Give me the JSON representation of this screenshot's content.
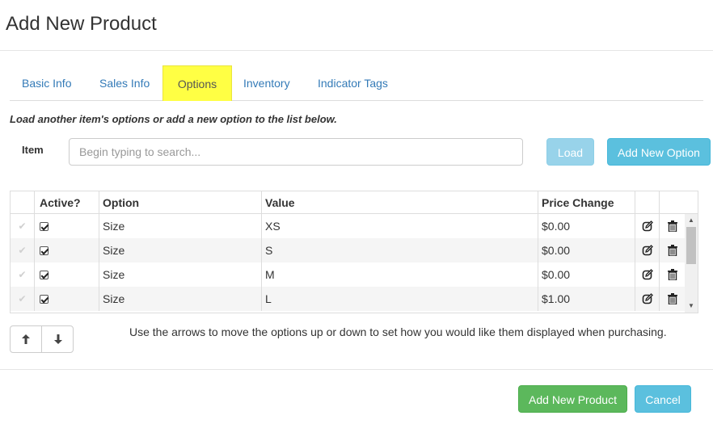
{
  "modal": {
    "title": "Add New Product"
  },
  "tabs": [
    {
      "label": "Basic Info",
      "active": false
    },
    {
      "label": "Sales Info",
      "active": false
    },
    {
      "label": "Options",
      "active": true
    },
    {
      "label": "Inventory",
      "active": false
    },
    {
      "label": "Indicator Tags",
      "active": false
    }
  ],
  "intro_text": "Load another item's options or add a new option to the list below.",
  "item_search": {
    "label": "Item",
    "placeholder": "Begin typing to search...",
    "value": ""
  },
  "buttons": {
    "load": "Load",
    "add_new_option": "Add New Option",
    "add_new_product": "Add New Product",
    "cancel": "Cancel"
  },
  "options_table": {
    "columns": [
      "",
      "Active?",
      "Option",
      "Value",
      "Price Change",
      "",
      ""
    ],
    "rows": [
      {
        "active": true,
        "option": "Size",
        "value": "XS",
        "price_change": "$0.00"
      },
      {
        "active": true,
        "option": "Size",
        "value": "S",
        "price_change": "$0.00"
      },
      {
        "active": true,
        "option": "Size",
        "value": "M",
        "price_change": "$0.00"
      },
      {
        "active": true,
        "option": "Size",
        "value": "L",
        "price_change": "$1.00"
      }
    ]
  },
  "help_text": "Use the arrows to move the options up or down to set how you would like them displayed when purchasing.",
  "colors": {
    "link": "#337ab7",
    "active_tab_highlight": "#ffff44",
    "info_button": "#5bc0de",
    "info_button_disabled": "#98d3ea",
    "success_button": "#5cb85c"
  },
  "icons": {
    "row_handle": "check-icon",
    "edit": "edit-icon",
    "delete": "trash-icon",
    "move_up": "arrow-up-icon",
    "move_down": "arrow-down-icon"
  }
}
